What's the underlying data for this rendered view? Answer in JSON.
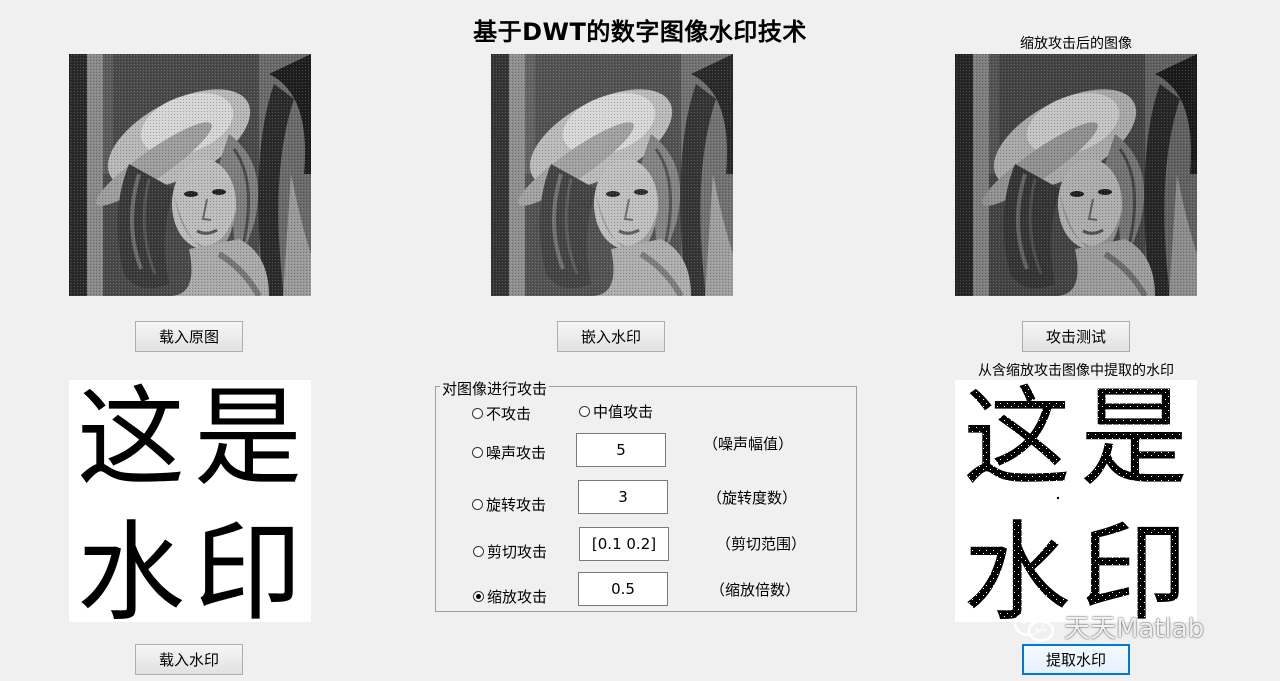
{
  "window": {
    "title": "基于DWT的数字图像水印技术"
  },
  "axes": {
    "attacked_title": "缩放攻击后的图像",
    "extracted_title": "从含缩放攻击图像中提取的水印"
  },
  "watermark": {
    "chars": [
      "这",
      "是",
      "水",
      "印"
    ]
  },
  "buttons": {
    "load_original": "载入原图",
    "embed_watermark": "嵌入水印",
    "attack_test": "攻击测试",
    "load_watermark": "载入水印",
    "extract_watermark": "提取水印"
  },
  "attack_panel": {
    "title": "对图像进行攻击",
    "options": {
      "none": "不攻击",
      "median": "中值攻击",
      "noise": "噪声攻击",
      "rotate": "旋转攻击",
      "crop": "剪切攻击",
      "scale": "缩放攻击"
    },
    "selected": "scale",
    "noise_value": "5",
    "rotate_value": "3",
    "crop_value": "[0.1 0.2]",
    "scale_value": "0.5",
    "noise_hint": "（噪声幅值）",
    "rotate_hint": "（旋转度数）",
    "crop_hint": "（剪切范围）",
    "scale_hint": "（缩放倍数）"
  },
  "branding": {
    "logo_text": "天天Matlab"
  }
}
